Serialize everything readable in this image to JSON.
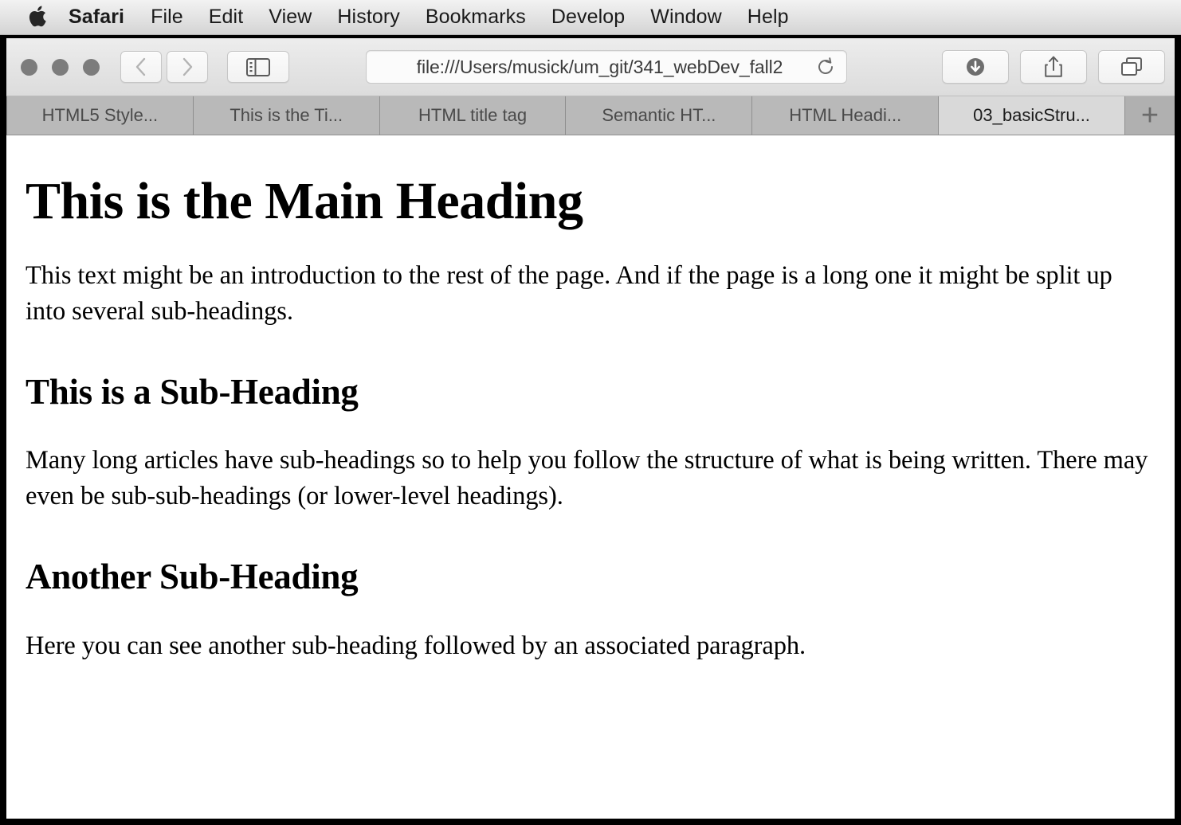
{
  "menubar": {
    "apple_icon": "apple-logo-icon",
    "items": [
      {
        "label": "Safari",
        "bold": true
      },
      {
        "label": "File",
        "bold": false
      },
      {
        "label": "Edit",
        "bold": false
      },
      {
        "label": "View",
        "bold": false
      },
      {
        "label": "History",
        "bold": false
      },
      {
        "label": "Bookmarks",
        "bold": false
      },
      {
        "label": "Develop",
        "bold": false
      },
      {
        "label": "Window",
        "bold": false
      },
      {
        "label": "Help",
        "bold": false
      }
    ]
  },
  "toolbar": {
    "traffic_lights": [
      "close",
      "minimize",
      "zoom"
    ],
    "back_icon": "chevron-left-icon",
    "forward_icon": "chevron-right-icon",
    "sidebar_icon": "sidebar-toggle-icon",
    "url": "file:///Users/musick/um_git/341_webDev_fall2",
    "url_placeholder": "Search or enter website name",
    "reload_icon": "reload-icon",
    "downloads_icon": "downloads-icon",
    "share_icon": "share-icon",
    "tabs_overview_icon": "tab-overview-icon"
  },
  "tabbar": {
    "tabs": [
      {
        "label": "HTML5 Style...",
        "active": false
      },
      {
        "label": "This is the Ti...",
        "active": false
      },
      {
        "label": "HTML title tag",
        "active": false
      },
      {
        "label": "Semantic HT...",
        "active": false
      },
      {
        "label": "HTML Headi...",
        "active": false
      },
      {
        "label": "03_basicStru...",
        "active": true
      }
    ],
    "new_tab_label": "+"
  },
  "page": {
    "h1": "This is the Main Heading",
    "intro": "This text might be an introduction to the rest of the page. And if the page is a long one it might be split up into several sub-headings.",
    "h2_first": "This is a Sub-Heading",
    "p_first": "Many long articles have sub-headings so to help you follow the structure of what is being written. There may even be sub-sub-headings (or lower-level headings).",
    "h2_second": "Another Sub-Heading",
    "p_second": "Here you can see another sub-heading followed by an associated paragraph."
  },
  "colors": {
    "menubar_bg": "#e8e8e8",
    "toolbar_bg": "#e4e4e4",
    "tabbar_bg": "#b0b0b0",
    "tab_inactive_bg": "#b9b9b9",
    "tab_active_bg": "#d9d9d9",
    "page_bg": "#ffffff",
    "frame": "#000000",
    "text": "#000000"
  }
}
